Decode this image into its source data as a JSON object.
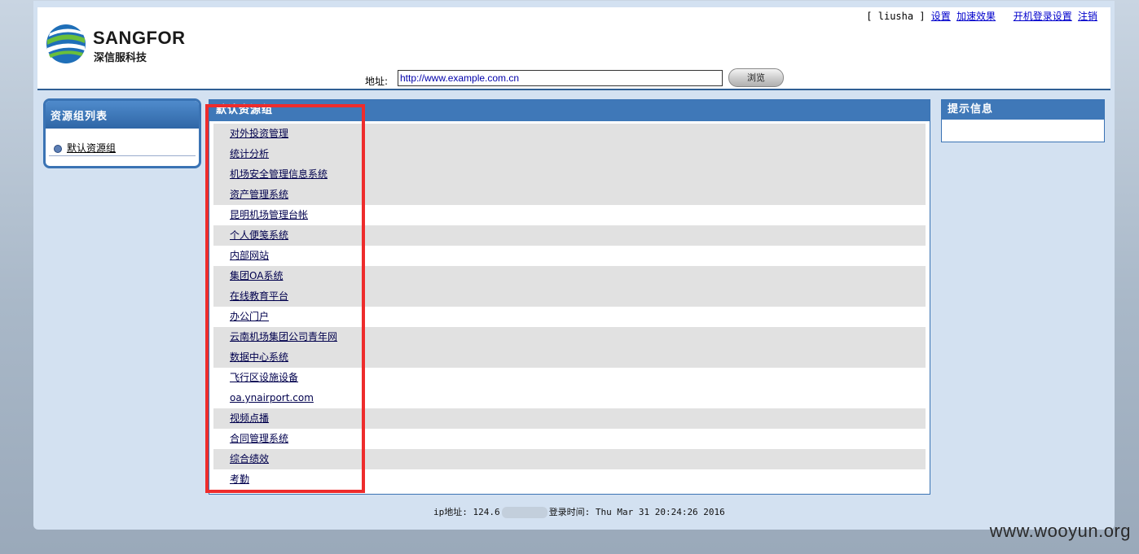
{
  "brand": {
    "name": "SANGFOR",
    "sub": "深信服科技"
  },
  "userbar": {
    "user": "[ liusha ]",
    "links": [
      "设置",
      "加速效果",
      "开机登录设置",
      "注销"
    ]
  },
  "address": {
    "label": "地址:",
    "value": "http://www.example.com.cn",
    "browse_label": "浏览"
  },
  "left_panel": {
    "title": "资源组列表",
    "items": [
      "默认资源组"
    ]
  },
  "main_panel": {
    "title": "默认资源组",
    "resources": [
      "对外投资管理",
      "统计分析",
      "机场安全管理信息系统",
      "资产管理系统",
      "昆明机场管理台帐",
      "个人便笺系统",
      "内部网站",
      "集团OA系统",
      "在线教育平台",
      "办公门户",
      "云南机场集团公司青年网",
      "数据中心系统",
      "飞行区设施设备",
      "oa.ynairport.com",
      "视频点播",
      "合同管理系统",
      "综合绩效",
      "考勤"
    ]
  },
  "right_panel": {
    "title": "提示信息"
  },
  "footer": {
    "ip_label": "ip地址: 124.6",
    "login_label": "登录时间: Thu Mar 31 20:24:26 2016"
  },
  "watermark": "www.wooyun.org",
  "colors": {
    "accent": "#3f78b8",
    "highlight": "#ee2c2c",
    "row_grey": "#e1e1e1"
  }
}
